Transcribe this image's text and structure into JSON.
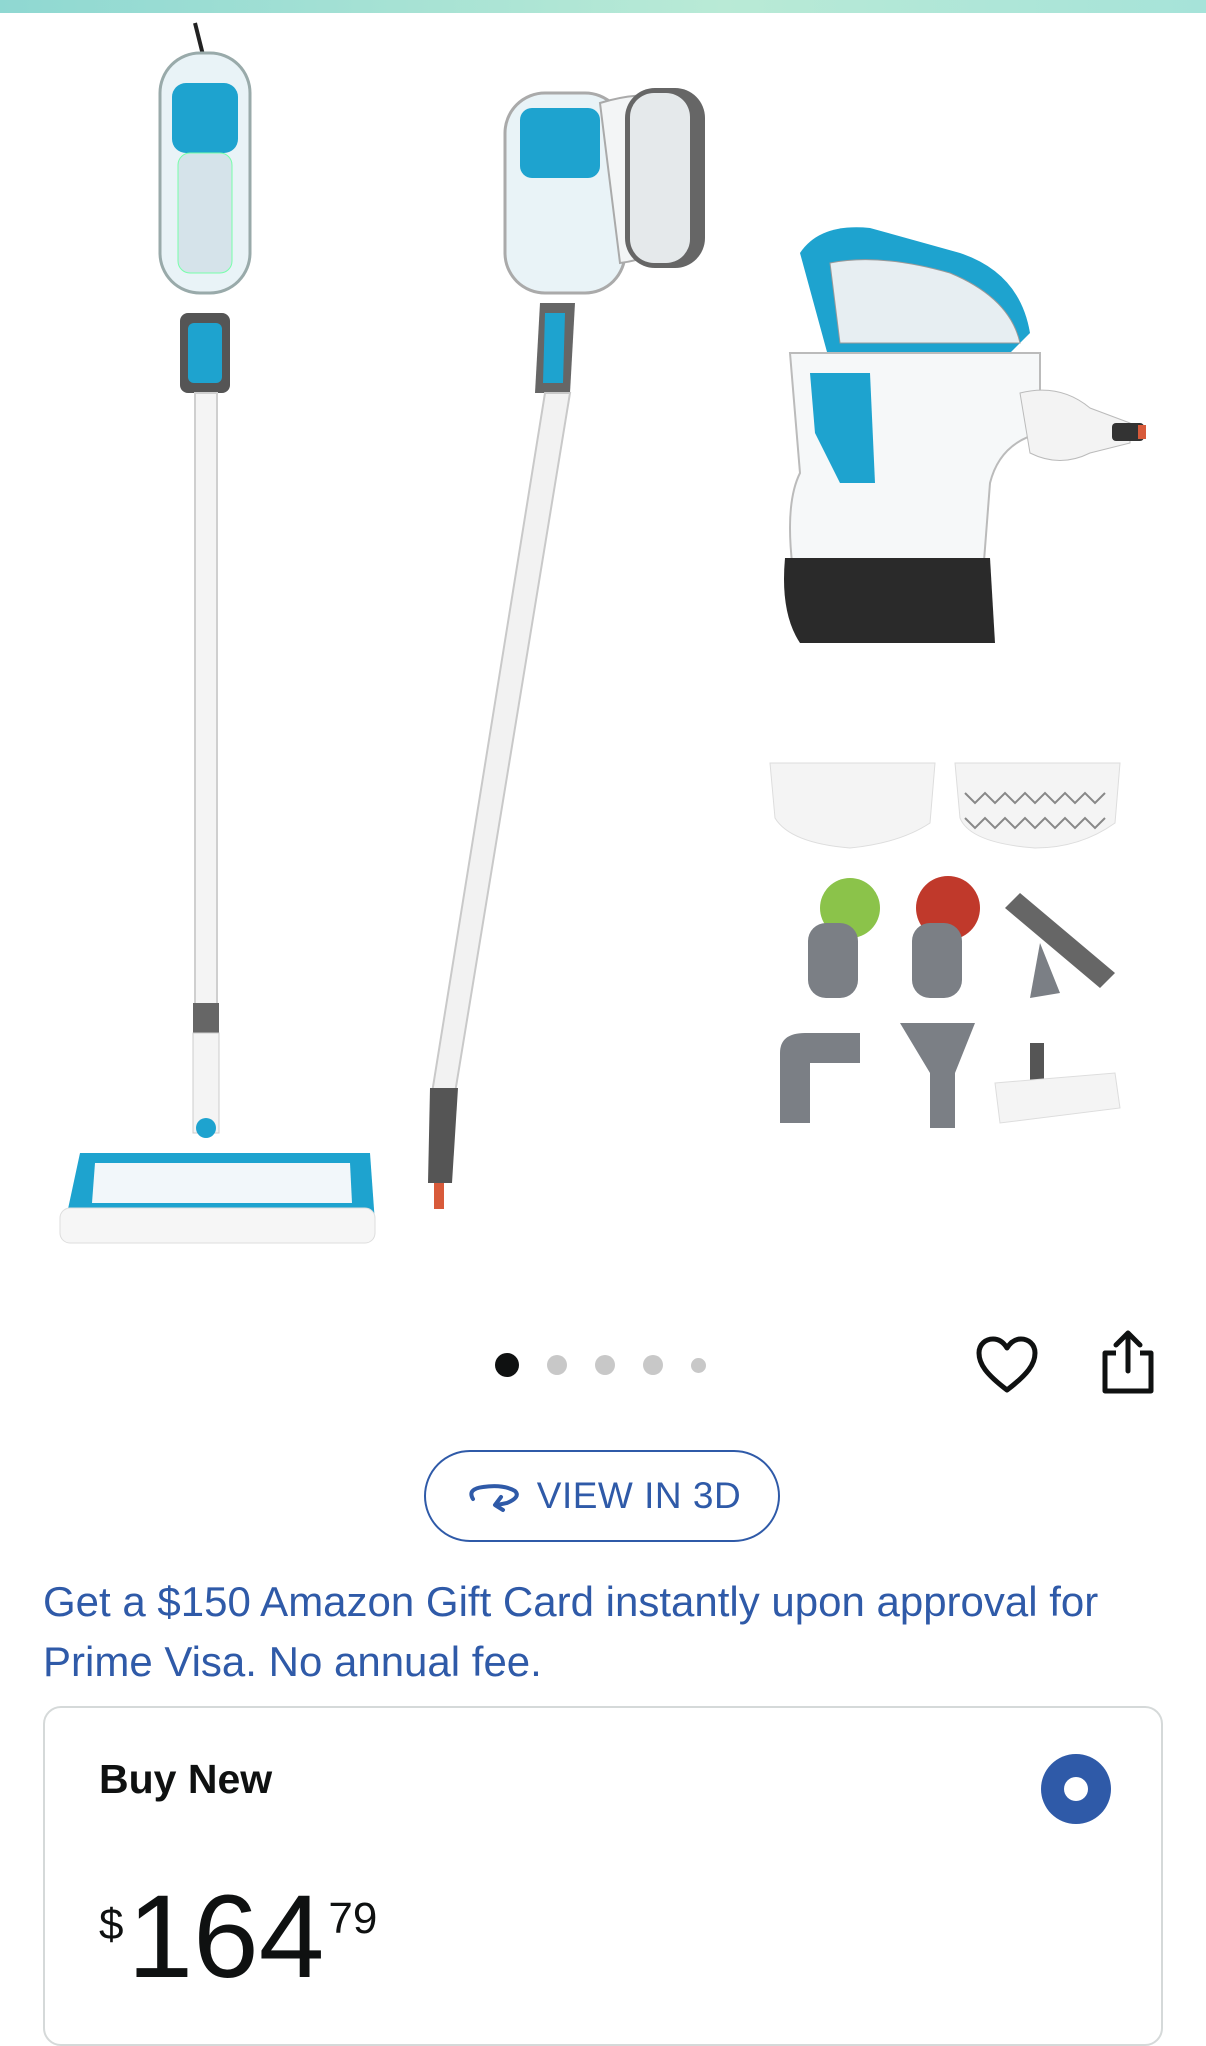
{
  "gallery": {
    "dot_count": 5,
    "active_index": 0,
    "product_images": [
      "steam-mop",
      "handheld-on-extension-wand",
      "handheld-steamer",
      "accessory-pads-and-tools"
    ]
  },
  "actions": {
    "wishlist_icon": "heart-icon",
    "share_icon": "share-icon"
  },
  "view3d": {
    "label": "VIEW IN 3D",
    "icon": "rotate-3d-icon"
  },
  "promo": {
    "text": "Get a $150 Amazon Gift Card instantly upon approval for Prime Visa. No annual fee."
  },
  "buy_box": {
    "title": "Buy New",
    "price": {
      "currency": "$",
      "whole": "164",
      "fraction": "79"
    }
  },
  "colors": {
    "link_blue": "#2f5aa8",
    "accent_teal": "#1ea3cf",
    "text": "#0f1111"
  }
}
